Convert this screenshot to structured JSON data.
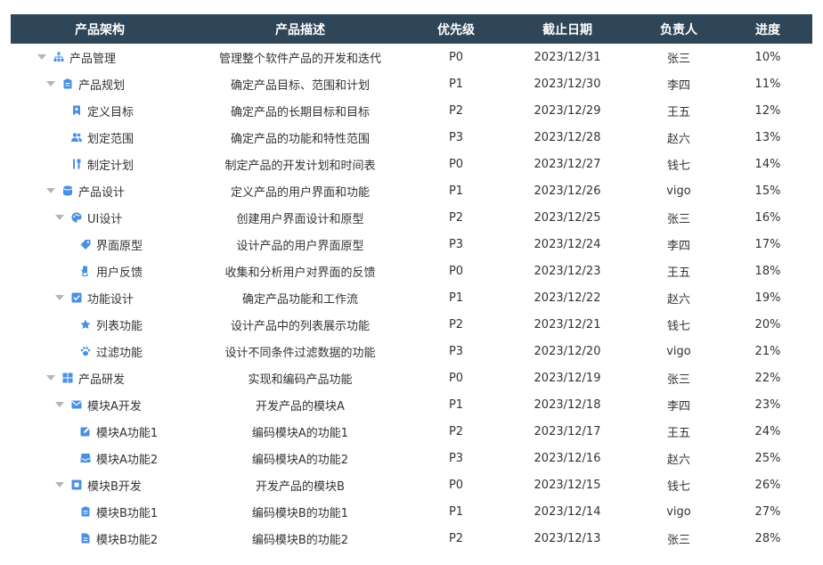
{
  "colors": {
    "header_bg": "#2f4558",
    "icon": "#4a90e2"
  },
  "headers": {
    "name": "产品架构",
    "desc": "产品描述",
    "priority": "优先级",
    "due": "截止日期",
    "owner": "负责人",
    "progress": "进度"
  },
  "rows": [
    {
      "level": 0,
      "expand": true,
      "icon": "sitemap-icon",
      "name": "产品管理",
      "desc": "管理整个软件产品的开发和迭代",
      "priority": "P0",
      "due": "2023/12/31",
      "owner": "张三",
      "progress": "10%"
    },
    {
      "level": 1,
      "expand": true,
      "icon": "clipboard-icon",
      "name": "产品规划",
      "desc": "确定产品目标、范围和计划",
      "priority": "P1",
      "due": "2023/12/30",
      "owner": "李四",
      "progress": "11%"
    },
    {
      "level": 2,
      "expand": false,
      "icon": "bookmark-icon",
      "name": "定义目标",
      "desc": "确定产品的长期目标和目标",
      "priority": "P2",
      "due": "2023/12/29",
      "owner": "王五",
      "progress": "12%"
    },
    {
      "level": 2,
      "expand": false,
      "icon": "users-icon",
      "name": "划定范围",
      "desc": "确定产品的功能和特性范围",
      "priority": "P3",
      "due": "2023/12/28",
      "owner": "赵六",
      "progress": "13%"
    },
    {
      "level": 2,
      "expand": false,
      "icon": "tools-icon",
      "name": "制定计划",
      "desc": "制定产品的开发计划和时间表",
      "priority": "P0",
      "due": "2023/12/27",
      "owner": "钱七",
      "progress": "14%"
    },
    {
      "level": 1,
      "expand": true,
      "icon": "database-icon",
      "name": "产品设计",
      "desc": "定义产品的用户界面和功能",
      "priority": "P1",
      "due": "2023/12/26",
      "owner": "vigo",
      "progress": "15%"
    },
    {
      "level": 2,
      "expand": true,
      "icon": "palette-icon",
      "name": "UI设计",
      "desc": "创建用户界面设计和原型",
      "priority": "P2",
      "due": "2023/12/25",
      "owner": "张三",
      "progress": "16%"
    },
    {
      "level": 3,
      "expand": false,
      "icon": "tag-icon",
      "name": "界面原型",
      "desc": "设计产品的用户界面原型",
      "priority": "P3",
      "due": "2023/12/24",
      "owner": "李四",
      "progress": "17%"
    },
    {
      "level": 3,
      "expand": false,
      "icon": "feedback-icon",
      "name": "用户反馈",
      "desc": "收集和分析用户对界面的反馈",
      "priority": "P0",
      "due": "2023/12/23",
      "owner": "王五",
      "progress": "18%"
    },
    {
      "level": 2,
      "expand": true,
      "icon": "checkbox-icon",
      "name": "功能设计",
      "desc": "确定产品功能和工作流",
      "priority": "P1",
      "due": "2023/12/22",
      "owner": "赵六",
      "progress": "19%"
    },
    {
      "level": 3,
      "expand": false,
      "icon": "star-icon",
      "name": "列表功能",
      "desc": "设计产品中的列表展示功能",
      "priority": "P2",
      "due": "2023/12/21",
      "owner": "钱七",
      "progress": "20%"
    },
    {
      "level": 3,
      "expand": false,
      "icon": "paw-icon",
      "name": "过滤功能",
      "desc": "设计不同条件过滤数据的功能",
      "priority": "P3",
      "due": "2023/12/20",
      "owner": "vigo",
      "progress": "21%"
    },
    {
      "level": 1,
      "expand": true,
      "icon": "grid-icon",
      "name": "产品研发",
      "desc": "实现和编码产品功能",
      "priority": "P0",
      "due": "2023/12/19",
      "owner": "张三",
      "progress": "22%"
    },
    {
      "level": 2,
      "expand": true,
      "icon": "mail-icon",
      "name": "模块A开发",
      "desc": "开发产品的模块A",
      "priority": "P1",
      "due": "2023/12/18",
      "owner": "李四",
      "progress": "23%"
    },
    {
      "level": 3,
      "expand": false,
      "icon": "edit-icon",
      "name": "模块A功能1",
      "desc": "编码模块A的功能1",
      "priority": "P2",
      "due": "2023/12/17",
      "owner": "王五",
      "progress": "24%"
    },
    {
      "level": 3,
      "expand": false,
      "icon": "inbox-icon",
      "name": "模块A功能2",
      "desc": "编码模块A的功能2",
      "priority": "P3",
      "due": "2023/12/16",
      "owner": "赵六",
      "progress": "25%"
    },
    {
      "level": 2,
      "expand": true,
      "icon": "module-icon",
      "name": "模块B开发",
      "desc": "开发产品的模块B",
      "priority": "P0",
      "due": "2023/12/15",
      "owner": "钱七",
      "progress": "26%"
    },
    {
      "level": 3,
      "expand": false,
      "icon": "clipboard-icon",
      "name": "模块B功能1",
      "desc": "编码模块B的功能1",
      "priority": "P1",
      "due": "2023/12/14",
      "owner": "vigo",
      "progress": "27%"
    },
    {
      "level": 3,
      "expand": false,
      "icon": "file-icon",
      "name": "模块B功能2",
      "desc": "编码模块B的功能2",
      "priority": "P2",
      "due": "2023/12/13",
      "owner": "张三",
      "progress": "28%"
    }
  ]
}
